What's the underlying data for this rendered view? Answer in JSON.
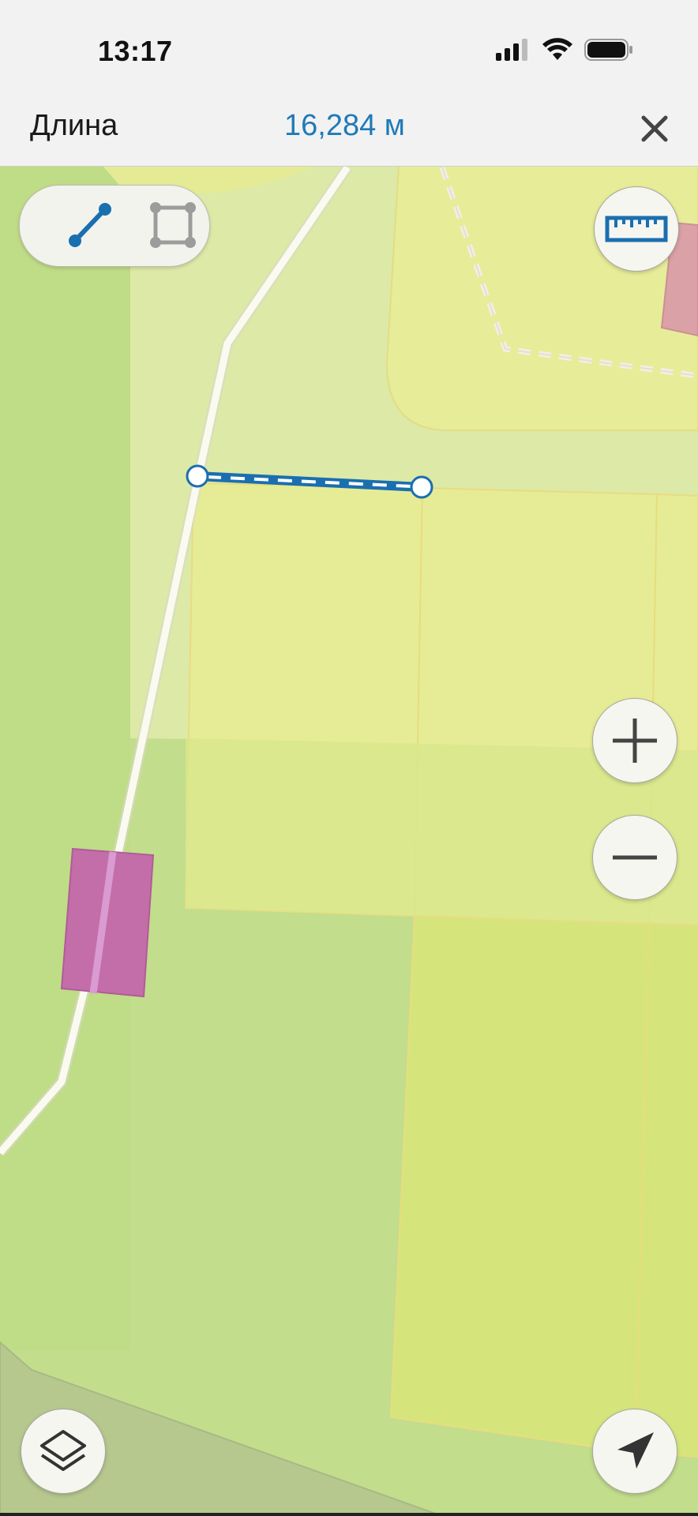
{
  "status_bar": {
    "time": "13:17"
  },
  "header": {
    "label": "Длина",
    "value": "16,284 м"
  },
  "icons": {
    "close": "close-icon",
    "line_mode": "line-measure-icon",
    "area_mode": "area-measure-icon",
    "ruler": "ruler-icon",
    "zoom_in": "plus-icon",
    "zoom_out": "minus-icon",
    "layers": "layers-icon",
    "location": "navigation-arrow-icon"
  },
  "colors": {
    "accent": "#1f7ab8",
    "measure_line": "#1a6fb0",
    "map_green": "#c2dd8c",
    "parcel_yellow": "#e8ec98",
    "building_magenta": "#c06aa8",
    "building_red": "#dba0a6"
  }
}
